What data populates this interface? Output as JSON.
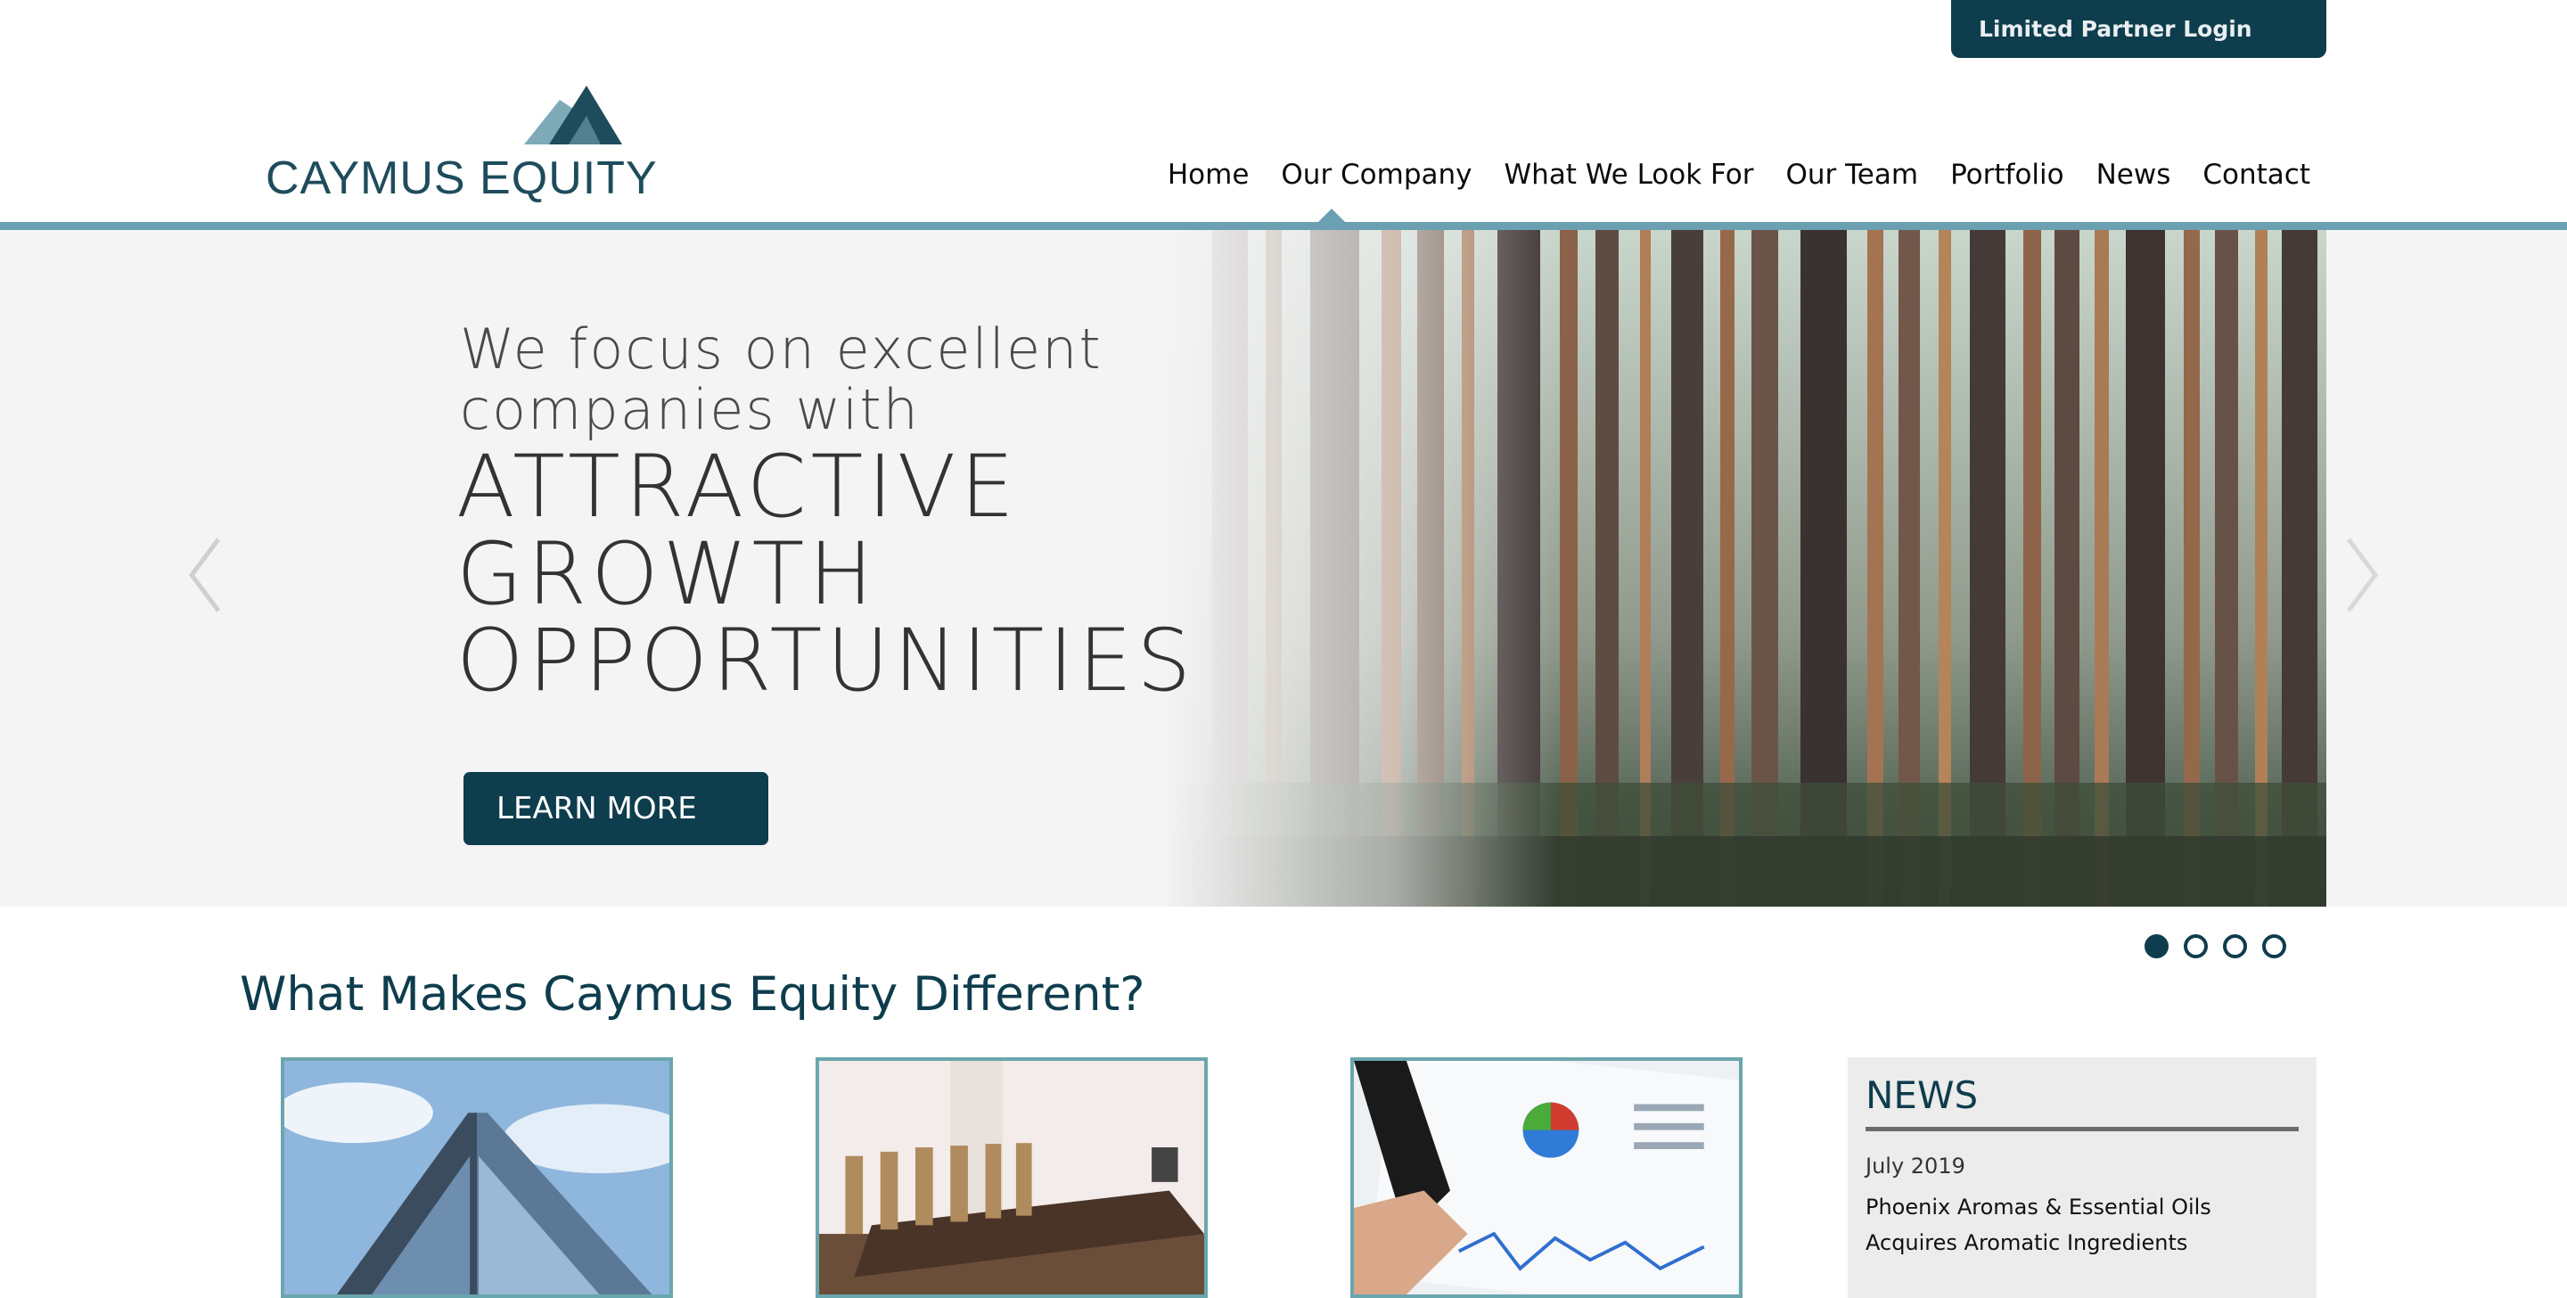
{
  "header": {
    "login_label": "Limited Partner Login",
    "logo_text": "CAYMUS EQUITY"
  },
  "nav": {
    "items": [
      {
        "label": "Home",
        "active": true
      },
      {
        "label": "Our Company"
      },
      {
        "label": "What We Look For"
      },
      {
        "label": "Our Team"
      },
      {
        "label": "Portfolio"
      },
      {
        "label": "News"
      },
      {
        "label": "Contact"
      }
    ]
  },
  "hero": {
    "line1": "We focus on excellent",
    "line2": "companies with",
    "big1": "ATTRACTIVE",
    "big2": "GROWTH",
    "big3": "OPPORTUNITIES",
    "button_label": "LEARN MORE",
    "slides_total": 4,
    "active_slide": 1
  },
  "section": {
    "title": "What Makes Caymus Equity Different?"
  },
  "news": {
    "title": "NEWS",
    "date": "July 2019",
    "headline": "Phoenix Aromas & Essential Oils Acquires Aromatic Ingredients"
  },
  "colors": {
    "brand_dark": "#0e3d4d",
    "brand_accent": "#6b9fb2",
    "card_border": "#6aa6ad"
  },
  "icons": [
    "chevron-left-icon",
    "chevron-right-icon"
  ]
}
